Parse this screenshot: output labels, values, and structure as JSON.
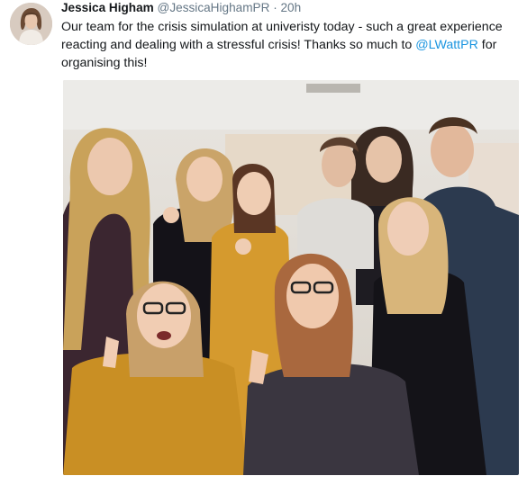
{
  "tweet": {
    "author_name": "Jessica Higham",
    "handle": "@JessicaHighamPR",
    "separator": "·",
    "time": "20h",
    "text_before": "Our team for the crisis simulation at univeristy today - such a great experience reacting and dealing with a stressful crisis! Thanks so much to ",
    "mention": "@LWattPR",
    "text_after": " for organising this!",
    "photo_description_icon": "group-photo"
  },
  "colors": {
    "mention": "#1b95e0",
    "secondary_text": "#657786",
    "primary_text": "#14171a"
  }
}
